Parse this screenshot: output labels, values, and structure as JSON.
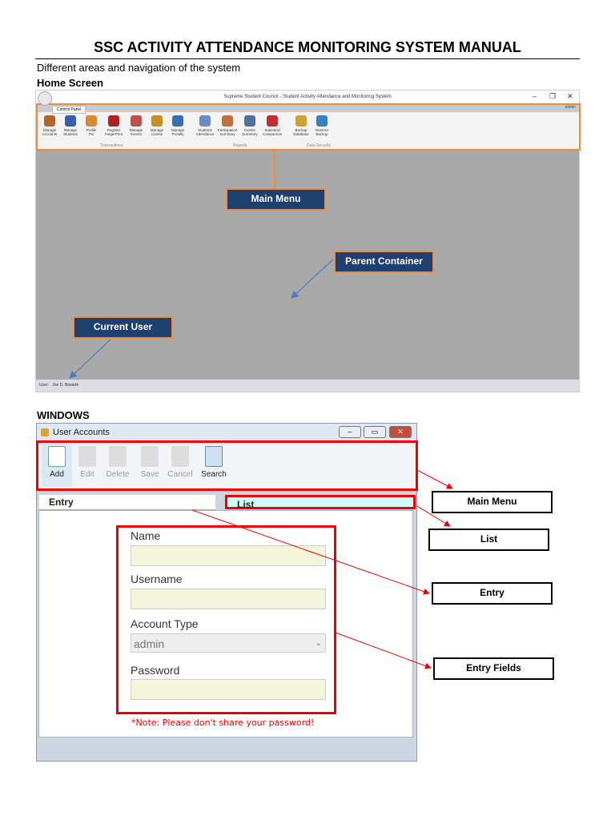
{
  "title": "SSC ACTIVITY ATTENDANCE MONITORING SYSTEM MANUAL",
  "intro": "Different areas and navigation of the system",
  "home_heading": "Home Screen",
  "home": {
    "window_title": "Supreme Student Council - Student Activity Attendance and Monitoring System",
    "controls": [
      "–",
      "❐",
      "✕"
    ],
    "user_badge": "admin",
    "tab": "Control Panel",
    "items": [
      {
        "l1": "Manage",
        "l2": "Accounts",
        "color": "#b5652a"
      },
      {
        "l1": "Manage",
        "l2": "Students",
        "color": "#3a5ea8"
      },
      {
        "l1": "Profile",
        "l2": "Pic",
        "color": "#d88a30"
      },
      {
        "l1": "Register",
        "l2": "FingerPrint",
        "color": "#b02020"
      },
      {
        "l1": "Manage",
        "l2": "Events",
        "color": "#c0504d"
      },
      {
        "l1": "Manage",
        "l2": "Course",
        "color": "#c89020"
      },
      {
        "l1": "Manage",
        "l2": "Penalty",
        "color": "#3a6fb0"
      },
      {
        "l1": "Students",
        "l2": "Attendance",
        "color": "#6a8cc0"
      },
      {
        "l1": "Participation",
        "l2": "Summary",
        "color": "#c07040"
      },
      {
        "l1": "Events",
        "l2": "Summary",
        "color": "#5070a0"
      },
      {
        "l1": "Statistical",
        "l2": "Comparison",
        "color": "#c03030"
      },
      {
        "l1": "Backup",
        "l2": "Database",
        "color": "#d0a030"
      },
      {
        "l1": "Restore",
        "l2": "Backup",
        "color": "#3a80c0"
      }
    ],
    "groups": [
      "Transactions",
      "Reports",
      "Data Security"
    ],
    "status_label": "User:",
    "status_user": "Joe D. Basarte",
    "callouts": {
      "main_menu": "Main Menu",
      "parent_container": "Parent Container",
      "current_user": "Current User"
    }
  },
  "windows_heading": "WINDOWS",
  "window": {
    "title": "User Accounts",
    "toolbar": [
      "Add",
      "Edit",
      "Delete",
      "Save",
      "Cancel",
      "Search"
    ],
    "tabs": {
      "entry": "Entry",
      "list": "List"
    },
    "fields": {
      "name": "Name",
      "username": "Username",
      "account_type": "Account Type",
      "account_type_value": "admin",
      "password": "Password"
    },
    "note": "*Note: Please don't share your password!",
    "callouts": {
      "main_menu": "Main Menu",
      "list": "List",
      "entry": "Entry",
      "entry_fields": "Entry Fields"
    }
  }
}
